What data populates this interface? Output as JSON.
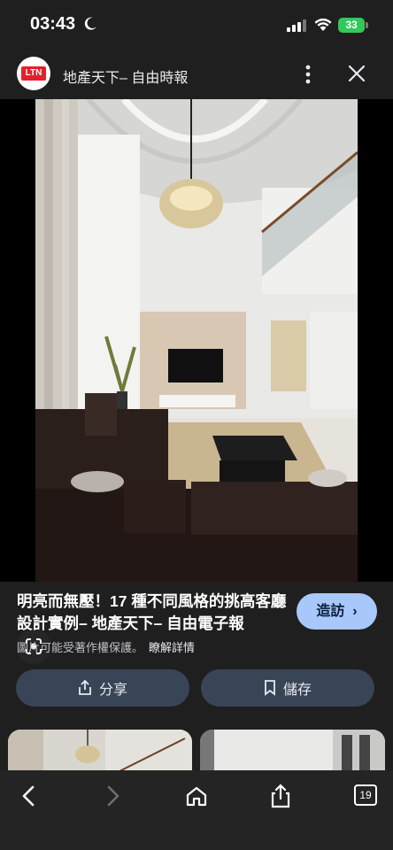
{
  "status_bar": {
    "time": "03:43",
    "battery": "33"
  },
  "header": {
    "logo_text": "LTN",
    "title": "地產天下– 自由時報"
  },
  "caption": {
    "title": "明亮而無壓！17 種不同風格的挑高客廳設計實例– 地產天下– 自由電子報",
    "copyright": "圖片可能受著作權保護。",
    "learn_more": "瞭解詳情"
  },
  "buttons": {
    "visit": "造訪",
    "share": "分享",
    "save": "儲存"
  },
  "toolbar": {
    "tab_count": "19"
  },
  "icons": [
    "moon-icon",
    "signal-icon",
    "wifi-icon",
    "more-icon",
    "close-icon",
    "lens-icon",
    "share-icon",
    "bookmark-icon",
    "back-icon",
    "forward-icon",
    "home-icon",
    "upload-icon",
    "tabs-icon"
  ]
}
